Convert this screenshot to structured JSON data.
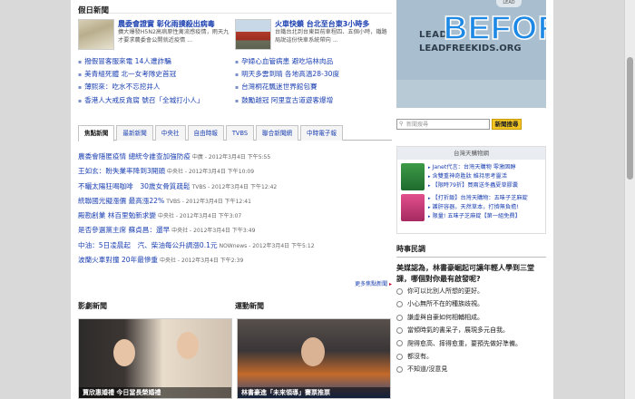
{
  "holiday": {
    "title": "假日新聞",
    "features": [
      {
        "title": "農委會證實 彰化雨撲殺出病毒",
        "desc": "擴大爆發H5N2高病原性禽流感疫情，雨天九才要求農委會公開就近疫情 ..."
      },
      {
        "title": "火車快鎖 台北至台東3小時多",
        "desc": "台鐵台北到台東目前車程四、五個小時，鐵路局說這份快車系統帶向 ..."
      }
    ],
    "bullets_left": [
      "撥假冒客服來電 14人遭詐騙",
      "美青組死體 北一女考隊史首冠",
      "薄熙來：吃水不忘挖井人",
      "香港人大戒反貪腐 號召「全城打小人」"
    ],
    "bullets_right": [
      "孕婦心血管病患 避吃培林肉品",
      "明天多雲到晴 各地高溫28-30度",
      "台灣桐花飄迷世界館包賽",
      "鼓勵越冠 阿里宣古道遊客爆增"
    ]
  },
  "tabs": [
    "焦點新聞",
    "最新新聞",
    "中央社",
    "自由時報",
    "TVBS",
    "聯合新聞網",
    "中時電子報"
  ],
  "news": [
    {
      "title": "農委會隱匿疫情 總統令誰查加強防疫",
      "src": "中廣 - 2012年3月4日 下午5:55"
    },
    {
      "title": "王如玄：盼失業率降到3開頭",
      "src": "中央社 - 2012年3月4日 下午10:09"
    },
    {
      "title": "不曬太陽狂喝咖啡　30歲女骨質疏鬆",
      "src": "TVBS - 2012年3月4日 下午12:42"
    },
    {
      "title": "統聯國光擬漲價 最高漲22%",
      "src": "TVBS - 2012年3月4日 下午12:41"
    },
    {
      "title": "殿勘創業 林百里勉新求變",
      "src": "中央社 - 2012年3月4日 下午3:07"
    },
    {
      "title": "是否參選黨主席 蘇貞昌：還早",
      "src": "中央社 - 2012年3月4日 下午3:49"
    },
    {
      "title": "中油：5日凌晨起　汽、柴油每公升調漲0.1元",
      "src": "NOWnews - 2012年3月4日 下午5:12"
    },
    {
      "title": "波蘭火車對撞 20年最慘重",
      "src": "中央社 - 2012年3月4日 下午2:39"
    }
  ],
  "more_link": "更多焦點新聞",
  "bottom": {
    "ent_title": "影劇新聞",
    "sport_title": "運動新聞",
    "ent_caption": "賈欣惠婚禮 今日當長榮婚禮",
    "sport_caption": "林書豪進「未來領導」賽票推票"
  },
  "ad": {
    "big_text": "BEFORE",
    "lead": "LEAD",
    "url": "LEADFREEKIDS.ORG",
    "badge": "LEAD"
  },
  "search": {
    "placeholder": "新聞搜尋",
    "button": "新聞搜尋"
  },
  "mall": {
    "title": "台灣天購物網",
    "item1": [
      "Janet代言：台灣天購物 零激固醇",
      "含雙重神奇胜肽 維持思考靈活",
      "【限時79折】買兩送冬蟲夏草膠囊"
    ],
    "item2": [
      "【打折飯】台灣天購物：五味子芝麻錠",
      "護肝容器，天然草本，打擠無負擔!",
      "限量! 五味子芝麻錠【第一組免費】"
    ]
  },
  "poll": {
    "title": "時事民調",
    "question": "美媒認為，林書豪崛起可讓年輕人學到三堂課，哪個對你最有啟發呢?",
    "options": [
      "你可以比別人所想的更好。",
      "小心無所不在的種族歧視。",
      "謙虛與自豪如何相輔相成。",
      "當傾時氣的書呆子，展現多元自我。",
      "爬得愈高、摔得愈重，要預先做好準備。",
      "都沒有。",
      "不知道/沒意見"
    ]
  },
  "colors": {
    "link": "#1a3fb0",
    "accent": "#f3c623",
    "ad_text": "#1e88e5"
  }
}
